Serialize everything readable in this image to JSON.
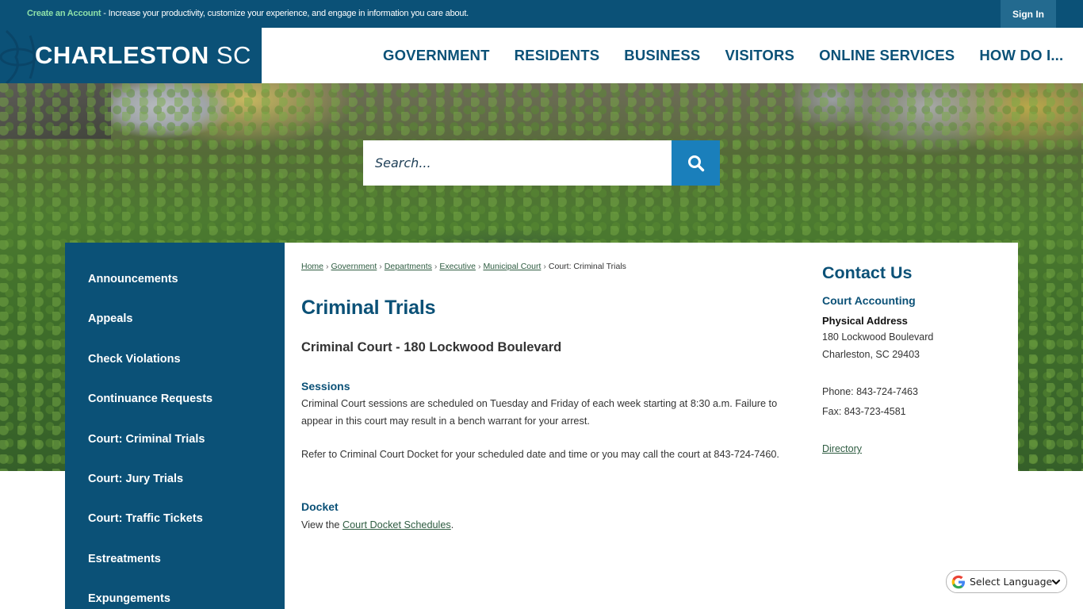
{
  "topbar": {
    "create_account_label": "Create an Account",
    "promo_text": " - Increase your productivity, customize your experience, and engage in information you care about.",
    "sign_in_label": "Sign In"
  },
  "header": {
    "brand_main": "CHARLESTON",
    "brand_suffix": " SC",
    "nav": [
      {
        "label": "GOVERNMENT"
      },
      {
        "label": "RESIDENTS"
      },
      {
        "label": "BUSINESS"
      },
      {
        "label": "VISITORS"
      },
      {
        "label": "ONLINE SERVICES"
      },
      {
        "label": "HOW DO I..."
      }
    ]
  },
  "search": {
    "placeholder": "Search...",
    "value": "",
    "button_icon": "search-icon"
  },
  "sidebar": {
    "items": [
      {
        "label": "Announcements"
      },
      {
        "label": "Appeals"
      },
      {
        "label": "Check Violations"
      },
      {
        "label": "Continuance Requests"
      },
      {
        "label": "Court: Criminal Trials"
      },
      {
        "label": "Court: Jury Trials"
      },
      {
        "label": "Court: Traffic Tickets"
      },
      {
        "label": "Estreatments"
      },
      {
        "label": "Expungements"
      }
    ]
  },
  "breadcrumb": {
    "links": [
      "Home",
      "Government",
      "Departments",
      "Executive",
      "Municipal Court"
    ],
    "separator": "›",
    "current": "Court: Criminal Trials"
  },
  "main": {
    "title": "Criminal Trials",
    "subheading": "Criminal Court - 180 Lockwood Boulevard",
    "sessions_heading": "Sessions",
    "sessions_p1": "Criminal Court sessions are scheduled on Tuesday and Friday of each week starting at 8:30 a.m. Failure to appear in this court may result in a bench warrant for your arrest.",
    "sessions_p2": "Refer to Criminal Court Docket for your scheduled date and time or you may call the court at 843-724-7460.",
    "docket_heading": "Docket",
    "docket_prefix": "View the ",
    "docket_link": "Court Docket Schedules",
    "docket_suffix": "."
  },
  "contact": {
    "heading": "Contact Us",
    "department": "Court Accounting",
    "address_label": "Physical Address",
    "address_line1": "180 Lockwood Boulevard",
    "address_line2": "Charleston, SC 29403",
    "phone": "Phone: 843-724-7463",
    "fax": "Fax: 843-723-4581",
    "directory_link": "Directory"
  },
  "language": {
    "selected": "Select Language"
  },
  "colors": {
    "brand": "#0b5177",
    "search_button": "#1a7fbb",
    "signin_bg": "#236a8f",
    "create_account": "#8ee0a8",
    "link": "#2f5d42"
  }
}
